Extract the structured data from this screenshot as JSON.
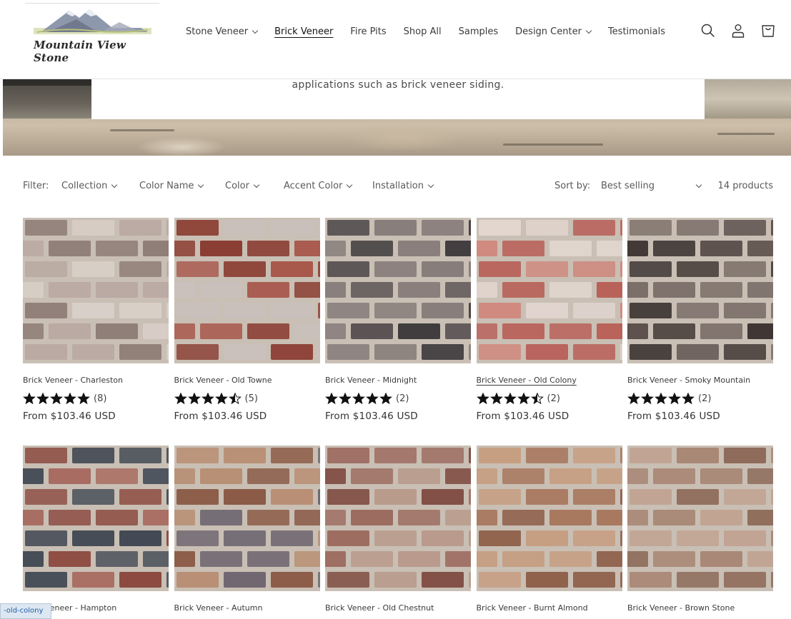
{
  "brand": {
    "logo_text": "Mountain View Stone"
  },
  "nav": {
    "items": [
      {
        "label": "Stone Veneer",
        "dropdown": true,
        "active": false
      },
      {
        "label": "Brick Veneer",
        "dropdown": false,
        "active": true
      },
      {
        "label": "Fire Pits",
        "dropdown": false,
        "active": false
      },
      {
        "label": "Shop All",
        "dropdown": false,
        "active": false
      },
      {
        "label": "Samples",
        "dropdown": false,
        "active": false
      },
      {
        "label": "Design Center",
        "dropdown": true,
        "active": false
      },
      {
        "label": "Testimonials",
        "dropdown": false,
        "active": false
      }
    ],
    "icons": [
      "search-icon",
      "account-icon",
      "cart-icon"
    ]
  },
  "banner": {
    "text": "applications such as brick veneer siding."
  },
  "filters": {
    "label": "Filter:",
    "items": [
      "Collection",
      "Color Name",
      "Color",
      "Accent Color",
      "Installation"
    ],
    "sort_label": "Sort by:",
    "sort_value": "Best selling",
    "count": "14 products"
  },
  "products": [
    {
      "title": "Brick Veneer - Charleston",
      "rating": 5,
      "reviews": "(8)",
      "price": "From $103.46 USD",
      "colors": [
        "#8e7d76",
        "#b9a9a2",
        "#d8cfc8"
      ],
      "hovered": false
    },
    {
      "title": "Brick Veneer - Old Towne",
      "rating": 4.5,
      "reviews": "(5)",
      "price": "From $103.46 USD",
      "colors": [
        "#8a3b30",
        "#a8574b",
        "#c9c0bc"
      ],
      "hovered": false
    },
    {
      "title": "Brick Veneer - Midnight",
      "rating": 5,
      "reviews": "(2)",
      "price": "From $103.46 USD",
      "colors": [
        "#3a3638",
        "#5a5254",
        "#847a78"
      ],
      "hovered": false
    },
    {
      "title": "Brick Veneer - Old Colony",
      "rating": 4.5,
      "reviews": "(2)",
      "price": "From $103.46 USD",
      "colors": [
        "#b85f57",
        "#cf8a7f",
        "#e2d6cf"
      ],
      "hovered": true
    },
    {
      "title": "Brick Veneer - Smoky Mountain",
      "rating": 5,
      "reviews": "(2)",
      "price": "From $103.46 USD",
      "colors": [
        "#3e3634",
        "#5d514d",
        "#7c6f69"
      ],
      "hovered": false
    },
    {
      "title": "Brick Veneer - Hampton",
      "colors": [
        "#8c4a40",
        "#a7675c",
        "#434a55"
      ],
      "hovered": false
    },
    {
      "title": "Brick Veneer - Autumn",
      "colors": [
        "#8a5a46",
        "#b88f74",
        "#6e6670"
      ],
      "hovered": false
    },
    {
      "title": "Brick Veneer - Old Chestnut",
      "colors": [
        "#7e4a40",
        "#9c6a5e",
        "#b8998a"
      ],
      "hovered": false
    },
    {
      "title": "Brick Veneer - Burnt Almond",
      "colors": [
        "#8d5d47",
        "#a8785e",
        "#c69d80"
      ],
      "hovered": false
    },
    {
      "title": "Brick Veneer - Brown Stone",
      "colors": [
        "#8d6a59",
        "#a88573",
        "#c1a392"
      ],
      "hovered": false
    }
  ],
  "status_chip": "-old-colony"
}
